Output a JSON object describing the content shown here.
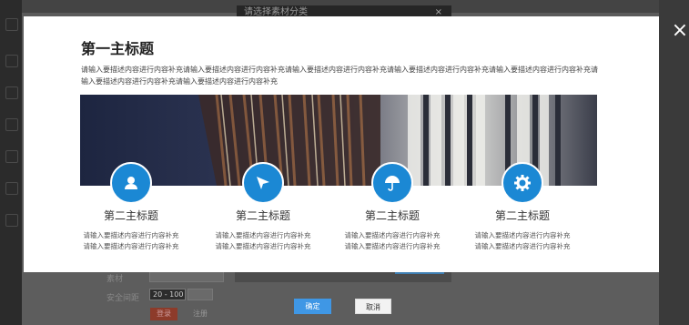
{
  "background": {
    "dialog_title": "请选择素材分类",
    "form": {
      "label_material": "素材",
      "label_safe_interval": "安全间距",
      "safe_interval_value": "20 - 100",
      "btn_red": "登录",
      "btn_plain": "注册"
    }
  },
  "modal": {
    "main_title": "第一主标题",
    "description": "请输入要描述内容进行内容补充请输入要描述内容进行内容补充请输入要描述内容进行内容补充请输入要描述内容进行内容补充请输入要描述内容进行内容补充请输入要描述内容进行内容补充请输入要描述内容进行内容补充",
    "features": [
      {
        "icon": "user-icon",
        "title": "第二主标题",
        "text": "请输入要描述内容进行内容补充请输入要描述内容进行内容补充"
      },
      {
        "icon": "send-icon",
        "title": "第二主标题",
        "text": "请输入要描述内容进行内容补充请输入要描述内容进行内容补充"
      },
      {
        "icon": "umbrella-icon",
        "title": "第二主标题",
        "text": "请输入要描述内容进行内容补充请输入要描述内容进行内容补充"
      },
      {
        "icon": "gear-icon",
        "title": "第二主标题",
        "text": "请输入要描述内容进行内容补充请输入要描述内容进行内容补充"
      }
    ]
  },
  "footer": {
    "confirm_label": "确定",
    "cancel_label": "取消"
  },
  "colors": {
    "accent": "#1b88d4",
    "confirm": "#3f97e5"
  }
}
